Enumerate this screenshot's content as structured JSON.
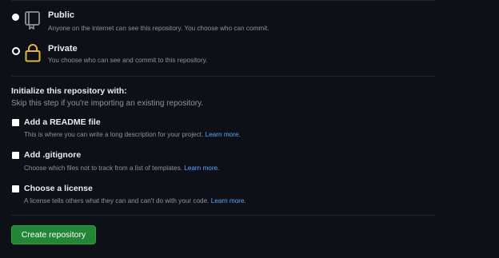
{
  "visibility": {
    "public": {
      "title": "Public",
      "description": "Anyone on the internet can see this repository. You choose who can commit.",
      "selected": false,
      "icon": "repo-icon"
    },
    "private": {
      "title": "Private",
      "description": "You choose who can see and commit to this repository.",
      "selected": true,
      "icon": "lock-icon"
    }
  },
  "initialize": {
    "heading": "Initialize this repository with:",
    "subtext": "Skip this step if you're importing an existing repository.",
    "options": [
      {
        "label": "Add a README file",
        "description": "This is where you can write a long description for your project.",
        "link": "Learn more.",
        "checked": false
      },
      {
        "label": "Add .gitignore",
        "description": "Choose which files not to track from a list of templates.",
        "link": "Learn more.",
        "checked": false
      },
      {
        "label": "Choose a license",
        "description": "A license tells others what they can and can't do with your code.",
        "link": "Learn more.",
        "checked": false
      }
    ]
  },
  "actions": {
    "create_label": "Create repository"
  },
  "colors": {
    "background": "#0d1117",
    "link": "#58a6ff",
    "button": "#238636",
    "lock": "#e3b341"
  }
}
